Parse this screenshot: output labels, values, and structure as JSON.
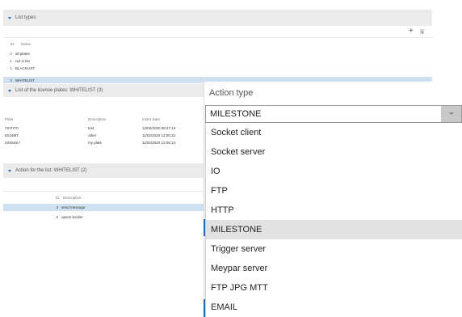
{
  "list_types": {
    "title": "List types",
    "toolbar": {
      "add_symbol": "+",
      "save_symbol": "🖫"
    },
    "headers": {
      "id": "ID",
      "name": "Name"
    },
    "rows": [
      {
        "id": "-2",
        "name": "all plates"
      },
      {
        "id": "-1",
        "name": "not in list"
      },
      {
        "id": "1",
        "name": "BLACKLIST"
      },
      {
        "id": "2",
        "name": "WHITELIST"
      }
    ]
  },
  "plates_list": {
    "title": "List of the license plates: WHITELIST (3)",
    "headers": {
      "plate": "Plate",
      "description": "Description",
      "insert_date": "Insert Date"
    },
    "rows": [
      {
        "plate": "7S7I7I7I",
        "description": "test",
        "date": "12/02/2020 08:47:13"
      },
      {
        "plate": "5X24MT",
        "description": "other",
        "date": "11/02/2020 12:05:32"
      },
      {
        "plate": "4X5S4K7",
        "description": "my plate",
        "date": "11/02/2020 12:05:13"
      }
    ]
  },
  "actions_list": {
    "title": "Action for the list: WHITELIST (2)",
    "headers": {
      "id": "ID",
      "description": "Description"
    },
    "rows": [
      {
        "id": "3",
        "description": "send message"
      },
      {
        "id": "2",
        "description": "opens border"
      }
    ]
  },
  "action_type": {
    "label": "Action type",
    "selected": "MILESTONE",
    "options": [
      "Socket client",
      "Socket server",
      "IO",
      "FTP",
      "HTTP",
      "MILESTONE",
      "Trigger server",
      "Meypar server",
      "FTP JPG MTT",
      "EMAIL"
    ],
    "highlighted_index": 5,
    "accent_color": "#2c6cb0",
    "highlight_color": "#e1e1e1"
  }
}
